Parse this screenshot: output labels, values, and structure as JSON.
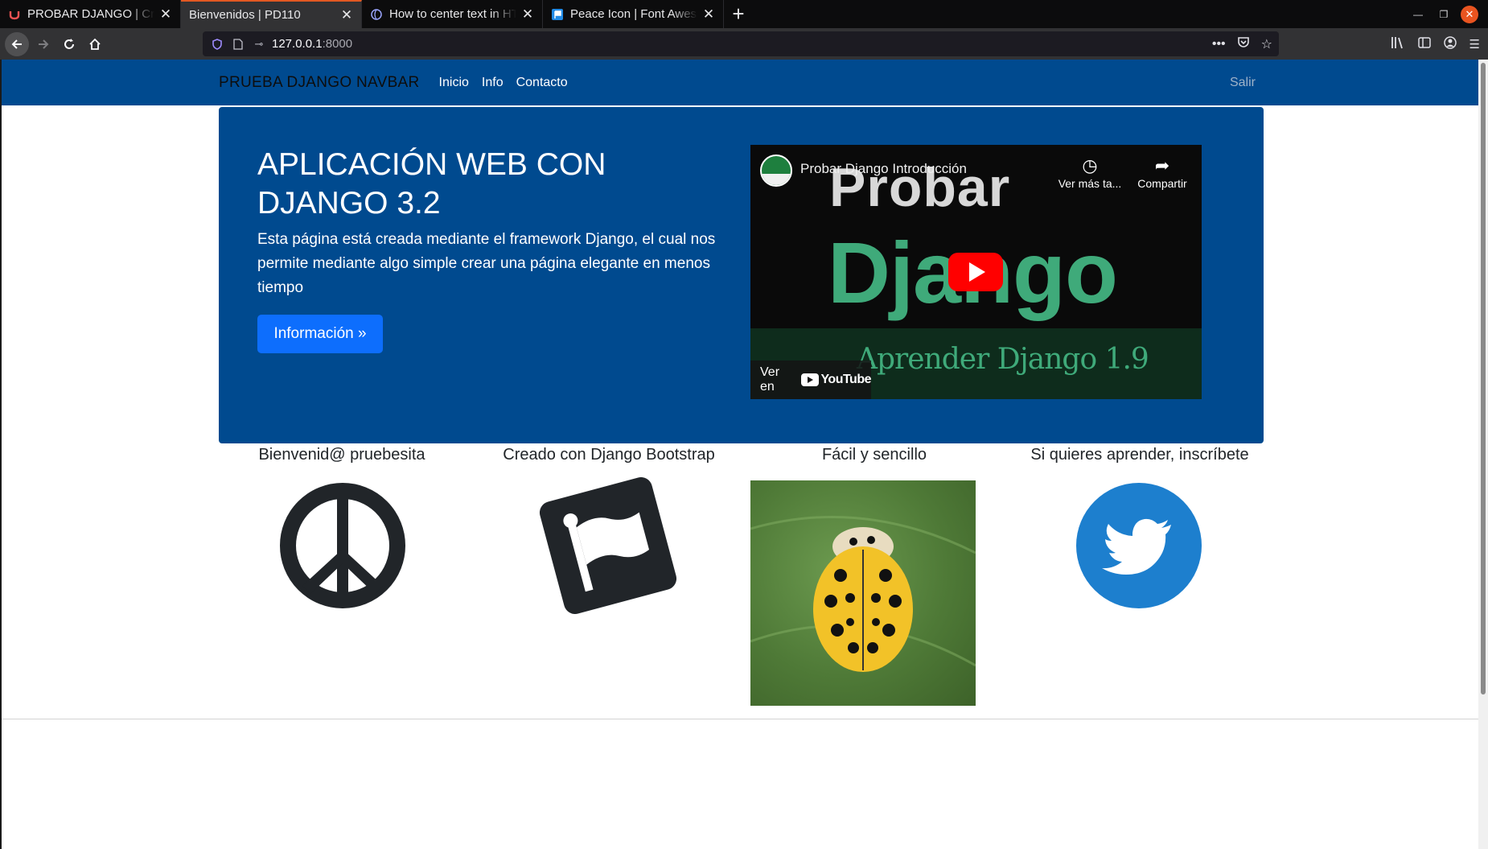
{
  "browser": {
    "tabs": [
      {
        "title": "PROBAR DJANGO | Crea",
        "active": false,
        "favicon": "udemy-icon"
      },
      {
        "title": "Bienvenidos | PD110",
        "active": true,
        "favicon": "none"
      },
      {
        "title": "How to center text in HT",
        "active": false,
        "favicon": "globe-icon"
      },
      {
        "title": "Peace Icon | Font Aweso",
        "active": false,
        "favicon": "fontawesome-icon"
      }
    ],
    "url_host": "127.0.0.1",
    "url_port": ":8000"
  },
  "site": {
    "brand": "PRUEBA DJANGO NAVBAR",
    "nav": [
      "Inicio",
      "Info",
      "Contacto"
    ],
    "logout": "Salir",
    "hero": {
      "title": "APLICACIÓN WEB CON DJANGO 3.2",
      "text": "Esta página está creada mediante el framework Django, el cual nos permite mediante algo simple crear una página elegante en menos tiempo",
      "button": "Información »"
    },
    "video": {
      "title": "Probar Django Introducción",
      "watch_later": "Ver más ta...",
      "share": "Compartir",
      "thumb_line1": "Probar",
      "thumb_line2": "Django",
      "thumb_line3": "Aprender Django 1.9",
      "watch_on": "Ver en",
      "youtube": "YouTube"
    },
    "features": [
      {
        "title": "Bienvenid@ pruebesita",
        "icon": "peace-icon"
      },
      {
        "title": "Creado con Django Bootstrap",
        "icon": "flag-icon"
      },
      {
        "title": "Fácil y sencillo",
        "icon": "ladybug-image"
      },
      {
        "title": "Si quieres aprender, inscríbete",
        "icon": "twitter-icon"
      }
    ]
  },
  "colors": {
    "navbar": "#004a8f",
    "button": "#0d6efd",
    "twitter": "#1d7fce",
    "icon_dark": "#212529"
  }
}
